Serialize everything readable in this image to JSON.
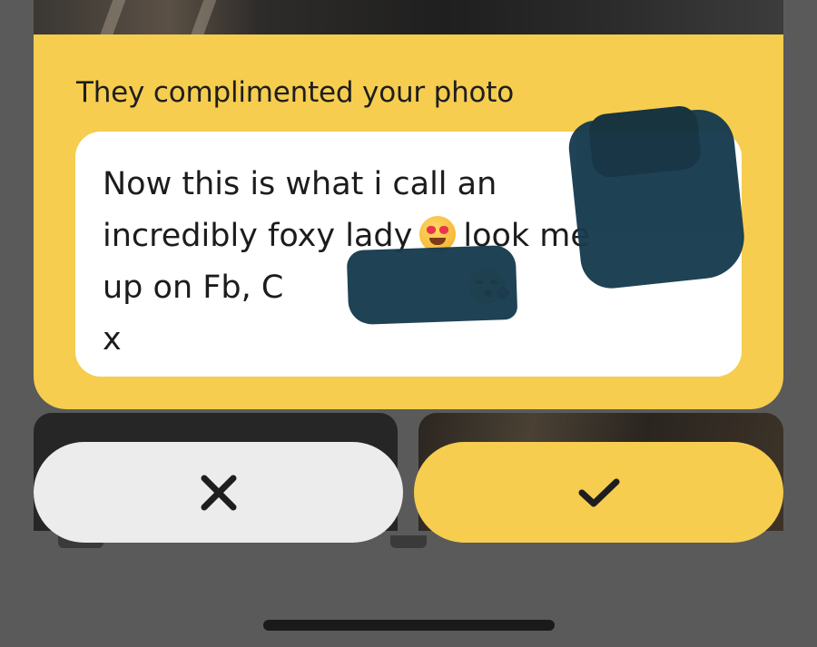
{
  "card": {
    "title": "They complimented your photo",
    "message_part1": "Now this is what i call an incredibly foxy lady",
    "message_part2": "look me up on Fb, C",
    "message_part3": "x"
  },
  "icons": {
    "emoji_1": "heart-eyes-emoji",
    "emoji_2": "kissing-emoji",
    "decline": "close-icon",
    "accept": "check-icon"
  },
  "colors": {
    "accent_yellow": "#f6cd4f",
    "decline_bg": "#ececec",
    "overlay": "#5a5a5a",
    "text": "#1c1c1c"
  }
}
